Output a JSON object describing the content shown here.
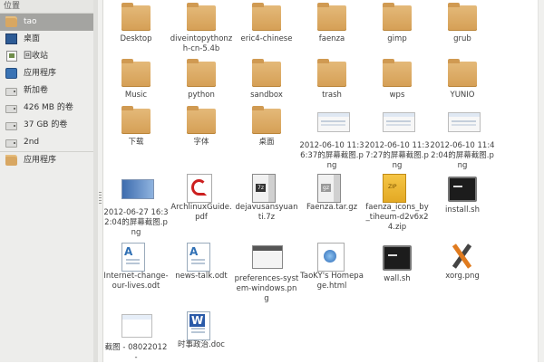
{
  "sidebar": {
    "header": "位置",
    "items": [
      {
        "label": "tao",
        "icon": "home-folder-icon",
        "selected": true
      },
      {
        "label": "桌面",
        "icon": "desktop-icon"
      },
      {
        "label": "回收站",
        "icon": "trash-icon"
      },
      {
        "label": "应用程序",
        "icon": "applications-icon"
      },
      {
        "label": "新加卷",
        "icon": "drive-icon"
      },
      {
        "label": "426 MB 的卷",
        "icon": "drive-icon"
      },
      {
        "label": "37 GB 的卷",
        "icon": "drive-icon"
      },
      {
        "label": "2nd",
        "icon": "drive-icon"
      },
      {
        "label": "应用程序",
        "icon": "folder-icon",
        "bookmark": true
      }
    ]
  },
  "files": [
    {
      "name": "Desktop",
      "type": "folder"
    },
    {
      "name": "diveintopythonzh-cn-5.4b",
      "type": "folder"
    },
    {
      "name": "eric4-chinese",
      "type": "folder"
    },
    {
      "name": "faenza",
      "type": "folder"
    },
    {
      "name": "gimp",
      "type": "folder"
    },
    {
      "name": "grub",
      "type": "folder"
    },
    {
      "name": "Music",
      "type": "folder"
    },
    {
      "name": "python",
      "type": "folder"
    },
    {
      "name": "sandbox",
      "type": "folder"
    },
    {
      "name": "trash",
      "type": "folder"
    },
    {
      "name": "wps",
      "type": "folder"
    },
    {
      "name": "YUNIO",
      "type": "folder"
    },
    {
      "name": "下载",
      "type": "folder"
    },
    {
      "name": "字体",
      "type": "folder"
    },
    {
      "name": "桌面",
      "type": "folder"
    },
    {
      "name": "2012-06-10 11:36:37的屏幕截图.png",
      "type": "screenshot"
    },
    {
      "name": "2012-06-10 11:37:27的屏幕截图.png",
      "type": "screenshot"
    },
    {
      "name": "2012-06-10 11:42:04的屏幕截图.png",
      "type": "screenshot"
    },
    {
      "name": "2012-06-27 16:32:04的屏幕截图.png",
      "type": "screenshot-blue"
    },
    {
      "name": "ArchlinuxGuide.pdf",
      "type": "pdf"
    },
    {
      "name": "dejavusansyuanti.7z",
      "type": "archive-7z"
    },
    {
      "name": "Faenza.tar.gz",
      "type": "archive-gz"
    },
    {
      "name": "faenza_icons_by_tiheum-d2v6x24.zip",
      "type": "zip"
    },
    {
      "name": "install.sh",
      "type": "script"
    },
    {
      "name": "Internet-change-our-lives.odt",
      "type": "doc"
    },
    {
      "name": "news-talk.odt",
      "type": "doc"
    },
    {
      "name": "preferences-system-windows.png",
      "type": "window-image"
    },
    {
      "name": "TaoKY's Homepage.html",
      "type": "html"
    },
    {
      "name": "wall.sh",
      "type": "script"
    },
    {
      "name": "xorg.png",
      "type": "xorg"
    },
    {
      "name": "截图 - 08022012 -",
      "type": "screenshot-small"
    },
    {
      "name": "时事政治.doc",
      "type": "word"
    }
  ]
}
